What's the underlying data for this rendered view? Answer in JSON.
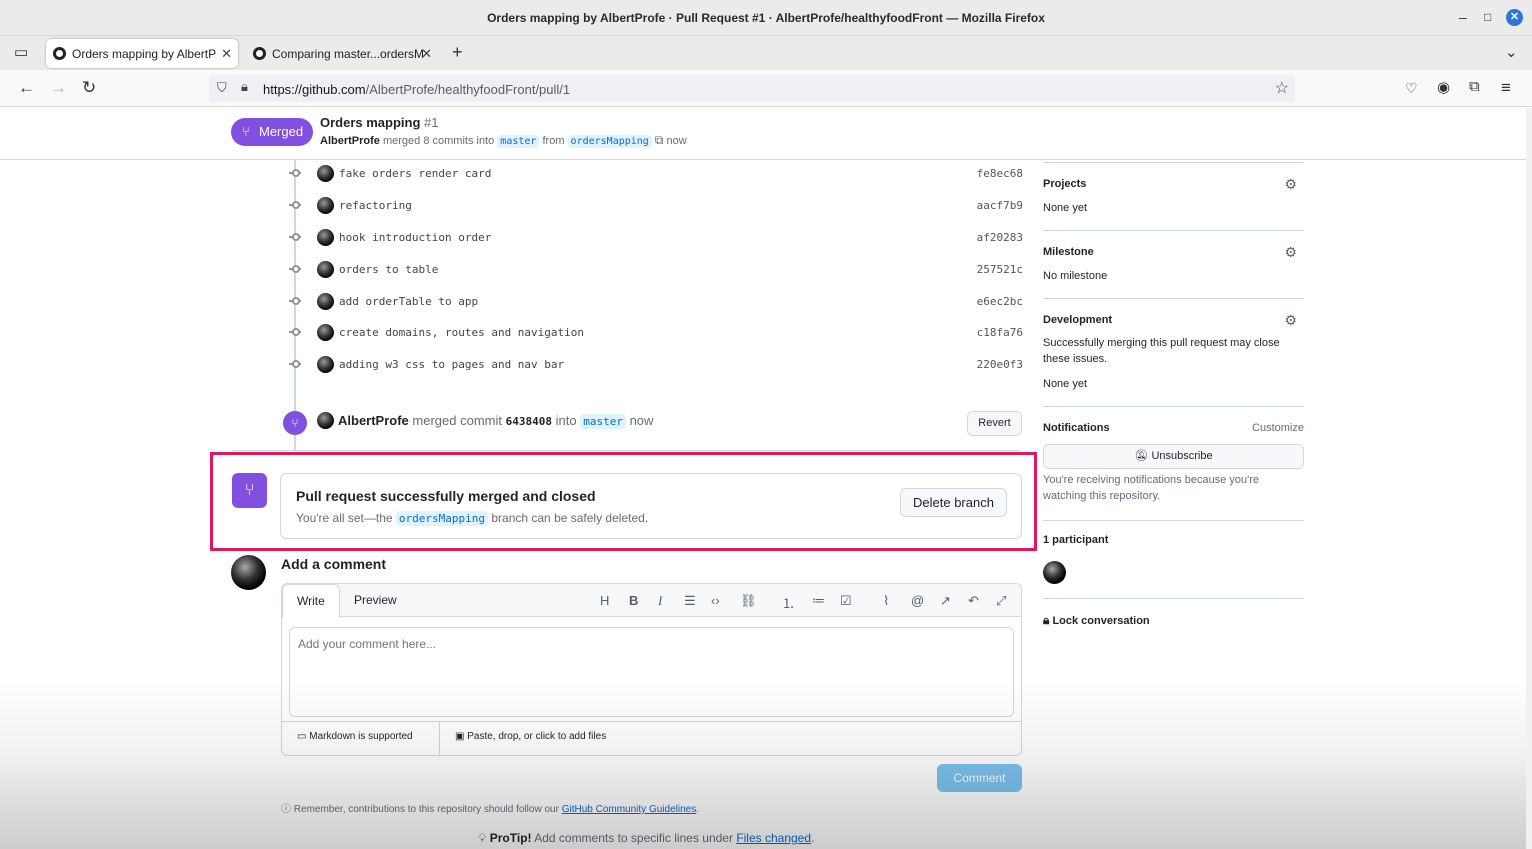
{
  "window": {
    "title": "Orders mapping by AlbertProfe · Pull Request #1 · AlbertProfe/healthyfoodFront — Mozilla Firefox",
    "minimize": "–",
    "maximize": "□",
    "close": "✕"
  },
  "tabs": [
    {
      "label": "Orders mapping by AlbertP",
      "active": true
    },
    {
      "label": "Comparing master...ordersM",
      "active": false
    }
  ],
  "browser": {
    "url_host": "https://github.com",
    "url_path": "/AlbertProfe/healthyfoodFront/pull/1"
  },
  "header": {
    "state_label": "Merged",
    "title": "Orders mapping",
    "number": "#1",
    "author": "AlbertProfe",
    "summary_text": "merged 8 commits into",
    "base_branch": "master",
    "from_text": "from",
    "head_branch": "ordersMapping",
    "time": "now"
  },
  "commits": [
    {
      "message": "fake orders render card",
      "sha": "fe8ec68"
    },
    {
      "message": "refactoring",
      "sha": "aacf7b9"
    },
    {
      "message": "hook introduction order",
      "sha": "af20283"
    },
    {
      "message": "orders to table",
      "sha": "257521c"
    },
    {
      "message": "add orderTable to app",
      "sha": "e6ec2bc"
    },
    {
      "message": "create domains, routes and navigation",
      "sha": "c18fa76"
    },
    {
      "message": "adding w3 css to pages and nav bar",
      "sha": "220e0f3"
    }
  ],
  "merge_event": {
    "author": "AlbertProfe",
    "text1": "merged commit",
    "sha": "6438408",
    "text2": "into",
    "branch": "master",
    "time": "now",
    "revert_label": "Revert"
  },
  "merged_box": {
    "heading": "Pull request successfully merged and closed",
    "text_before": "You're all set—the",
    "branch": "ordersMapping",
    "text_after": "branch can be safely deleted.",
    "delete_label": "Delete branch"
  },
  "comment": {
    "heading": "Add a comment",
    "tab_write": "Write",
    "tab_preview": "Preview",
    "placeholder": "Add your comment here...",
    "markdown_note": "Markdown is supported",
    "files_note": "Paste, drop, or click to add files",
    "submit_label": "Comment",
    "guidelines_text": "Remember, contributions to this repository should follow our",
    "guidelines_link": "GitHub Community Guidelines",
    "protip_label": "ProTip!",
    "protip_text": "Add comments to specific lines under",
    "protip_link": "Files changed"
  },
  "sidebar": {
    "projects_label": "Projects",
    "projects_value": "None yet",
    "milestone_label": "Milestone",
    "milestone_value": "No milestone",
    "development_label": "Development",
    "development_text": "Successfully merging this pull request may close these issues.",
    "development_value": "None yet",
    "notifications_label": "Notifications",
    "customize_label": "Customize",
    "unsubscribe_label": "Unsubscribe",
    "notifications_text": "You're receiving notifications because you're watching this repository.",
    "participants_label": "1 participant",
    "lock_label": "Lock conversation"
  }
}
